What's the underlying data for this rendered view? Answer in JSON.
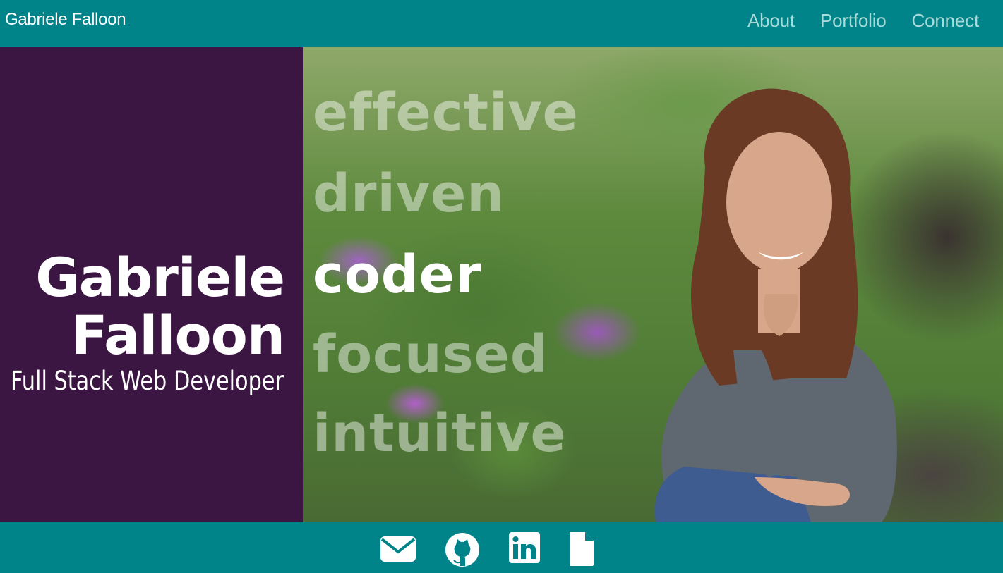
{
  "navbar": {
    "brand": "Gabriele Falloon",
    "links": [
      "About",
      "Portfolio",
      "Connect"
    ]
  },
  "hero": {
    "name_first": "Gabriele",
    "name_last": "Falloon",
    "subtitle": "Full Stack Web Developer",
    "words": [
      "effective",
      "driven",
      "coder",
      "focused",
      "intuitive"
    ],
    "active_word": "coder"
  },
  "footer": {
    "icons": [
      "envelope-icon",
      "github-icon",
      "linkedin-icon",
      "document-icon"
    ]
  },
  "colors": {
    "teal": "#008489",
    "purple": "#3c1642",
    "nav_link": "#a7dbd9"
  }
}
